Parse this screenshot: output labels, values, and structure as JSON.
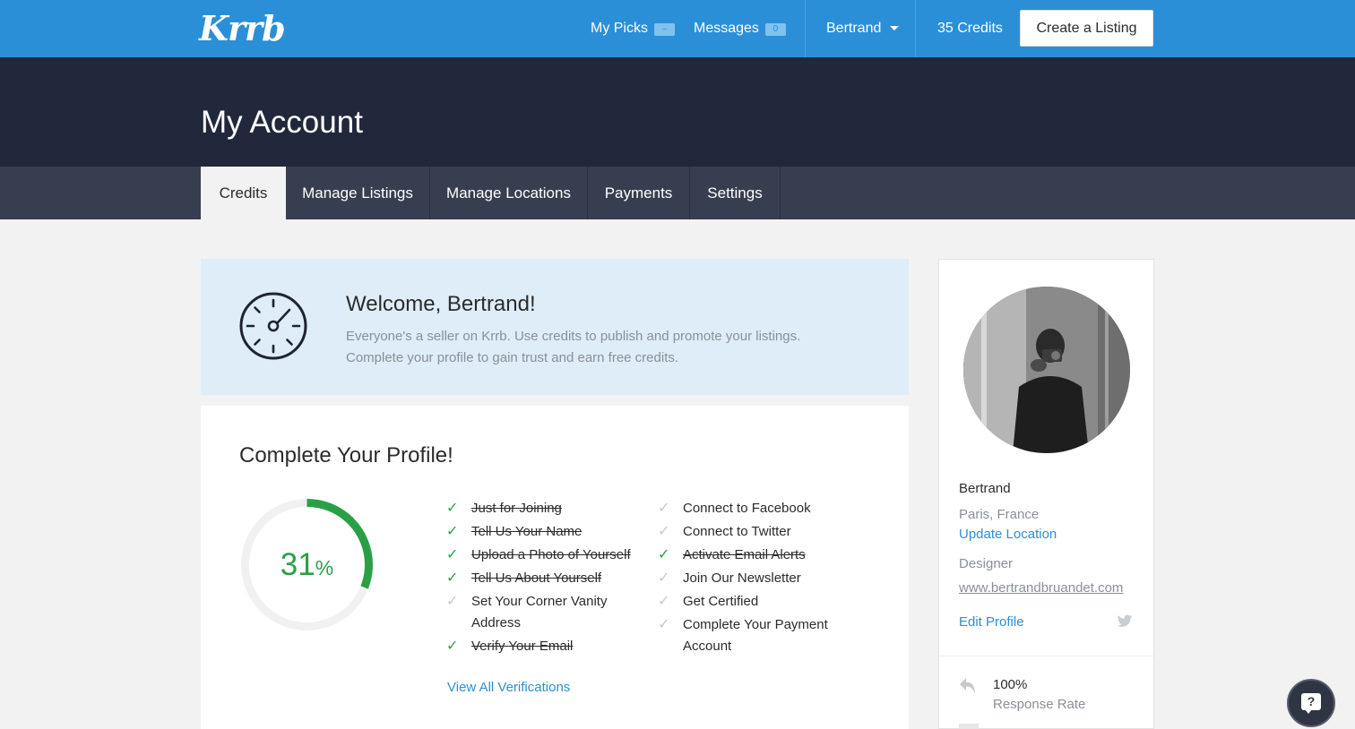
{
  "brand": {
    "logo": "Krrb"
  },
  "topnav": {
    "my_picks": "My Picks",
    "my_picks_badge": "–",
    "messages": "Messages",
    "messages_badge": "0",
    "user": "Bertrand",
    "credits": "35 Credits",
    "create_listing": "Create a Listing"
  },
  "page": {
    "title": "My Account"
  },
  "tabs": [
    {
      "label": "Credits",
      "active": true
    },
    {
      "label": "Manage Listings",
      "active": false
    },
    {
      "label": "Manage Locations",
      "active": false
    },
    {
      "label": "Payments",
      "active": false
    },
    {
      "label": "Settings",
      "active": false
    }
  ],
  "welcome": {
    "title": "Welcome, Bertrand!",
    "line1": "Everyone's a seller on Krrb. Use credits to publish and promote your listings.",
    "line2": "Complete your profile to gain trust and earn free credits."
  },
  "profile_completion": {
    "title": "Complete Your Profile!",
    "percent": 31,
    "percent_number": "31",
    "percent_sign": "%",
    "left_tasks": [
      {
        "label": "Just for Joining",
        "done": true
      },
      {
        "label": "Tell Us Your Name",
        "done": true
      },
      {
        "label": "Upload a Photo of Yourself",
        "done": true
      },
      {
        "label": "Tell Us About Yourself",
        "done": true
      },
      {
        "label": "Set Your Corner Vanity Address",
        "done": false
      },
      {
        "label": "Verify Your Email",
        "done": true
      }
    ],
    "right_tasks": [
      {
        "label": "Connect to Facebook",
        "done": false
      },
      {
        "label": "Connect to Twitter",
        "done": false
      },
      {
        "label": "Activate Email Alerts",
        "done": true
      },
      {
        "label": "Join Our Newsletter",
        "done": false
      },
      {
        "label": "Get Certified",
        "done": false
      },
      {
        "label": "Complete Your Payment Account",
        "done": false
      }
    ],
    "view_all": "View All Verifications"
  },
  "sidebar": {
    "name": "Bertrand",
    "location": "Paris, France",
    "update_location": "Update Location",
    "role": "Designer",
    "website": "www.bertrandbruandet.com",
    "edit_profile": "Edit Profile",
    "response_rate": "100%",
    "response_rate_label": "Response Rate"
  },
  "help": {
    "icon": "?"
  },
  "icons": {
    "clock": "stopwatch-icon",
    "check": "checkmark-icon",
    "twitter": "twitter-bird-icon",
    "reply": "reply-arrow-icon",
    "help": "help-chat-icon"
  },
  "colors": {
    "brand_blue": "#2b8fd8",
    "hero_dark": "#21283b",
    "tabbar": "#373e4f",
    "success_green": "#2aa046",
    "welcome_bg": "#deedf8"
  }
}
